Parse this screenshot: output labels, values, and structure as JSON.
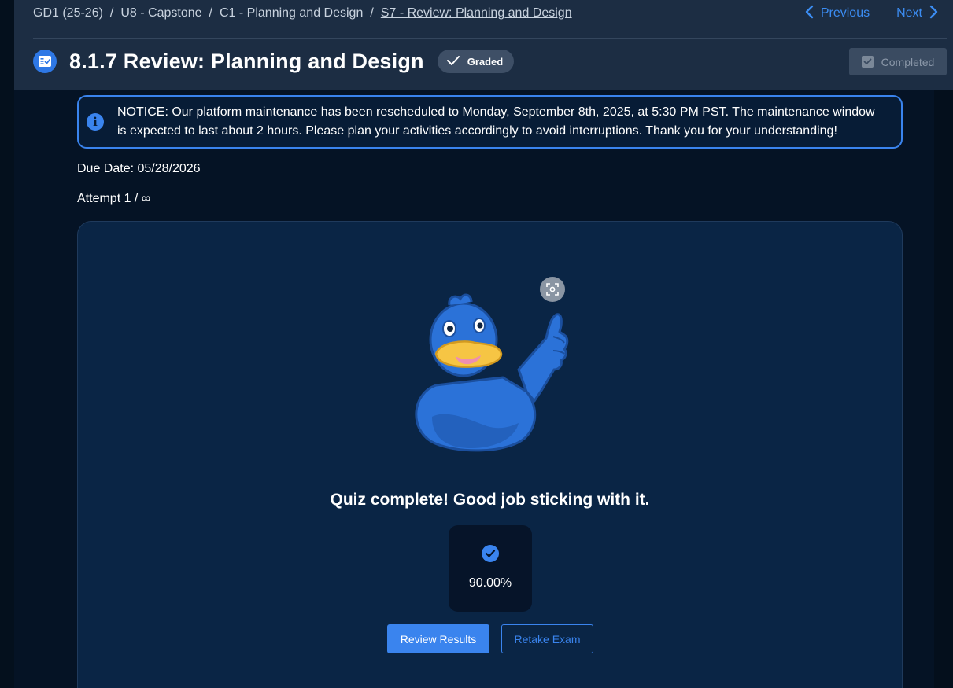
{
  "breadcrumb": {
    "items": [
      "GD1 (25-26)",
      "U8 - Capstone",
      "C1 - Planning and Design",
      "S7 - Review: Planning and Design"
    ],
    "separator": "/"
  },
  "nav": {
    "previous_label": "Previous",
    "next_label": "Next"
  },
  "header": {
    "title": "8.1.7 Review: Planning and Design",
    "graded_label": "Graded",
    "completed_label": "Completed"
  },
  "notice": {
    "text": "NOTICE: Our platform maintenance has been rescheduled to Monday, September 8th, 2025, at 5:30 PM PST. The maintenance window is expected to last about 2 hours. Please plan your activities accordingly to avoid interruptions. Thank you for your understanding!"
  },
  "due_date": "Due Date: 05/28/2026",
  "attempt": "Attempt 1 / ∞",
  "result": {
    "message": "Quiz complete! Good job sticking with it.",
    "score": "90.00%",
    "review_button": "Review Results",
    "retake_button": "Retake Exam"
  },
  "icons": {
    "title": "assignment-check-icon",
    "graded": "check-icon",
    "completed": "checkbox-icon",
    "notice": "info-icon",
    "score": "check-circle-icon",
    "mascot": "duck-thumbs-up-illustration",
    "focus": "focus-icon"
  },
  "colors": {
    "accent": "#3a84ee",
    "header_bg": "#1c2d43",
    "page_bg": "#051325",
    "card_bg": "#0a2545",
    "duck_blue": "#2b72d8",
    "beak_yellow": "#f6c544"
  }
}
